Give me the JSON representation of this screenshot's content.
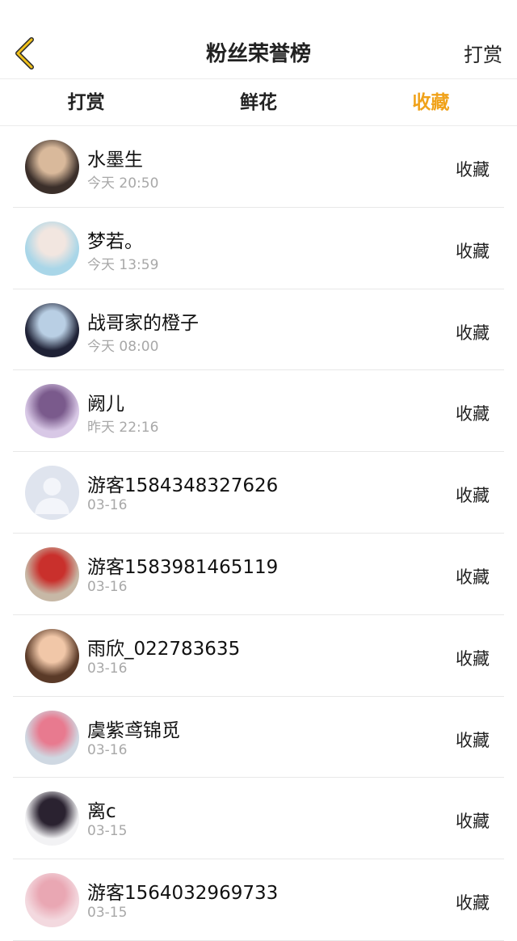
{
  "header": {
    "title": "粉丝荣誉榜",
    "right_label": "打赏",
    "back_icon": "chevron-left-icon",
    "accent": "#f0a21a"
  },
  "tabs": [
    {
      "label": "打赏",
      "active": false
    },
    {
      "label": "鲜花",
      "active": false
    },
    {
      "label": "收藏",
      "active": true
    }
  ],
  "fans": [
    {
      "name": "水墨生",
      "time": "今天 20:50",
      "action": "收藏",
      "avatar_colors": [
        "#3b2f2a",
        "#d9b99b"
      ]
    },
    {
      "name": "梦若。",
      "time": "今天 13:59",
      "action": "收藏",
      "avatar_colors": [
        "#a9d6e8",
        "#f2e6e0"
      ]
    },
    {
      "name": "战哥家的橙子",
      "time": "今天 08:00",
      "action": "收藏",
      "avatar_colors": [
        "#1f2236",
        "#b9cfe4"
      ]
    },
    {
      "name": "阙儿",
      "time": "昨天 22:16",
      "action": "收藏",
      "avatar_colors": [
        "#d8c8e6",
        "#7a5a8c"
      ]
    },
    {
      "name": "游客1584348327626",
      "time": "03-16",
      "action": "收藏",
      "avatar_colors": [
        "#dfe4ee",
        "#c4cbdb"
      ]
    },
    {
      "name": "游客1583981465119",
      "time": "03-16",
      "action": "收藏",
      "avatar_colors": [
        "#c7b8a6",
        "#c9302c"
      ]
    },
    {
      "name": "雨欣_022783635",
      "time": "03-16",
      "action": "收藏",
      "avatar_colors": [
        "#5a3a28",
        "#f1c7a8"
      ]
    },
    {
      "name": "虞紫鸢锦觅",
      "time": "03-16",
      "action": "收藏",
      "avatar_colors": [
        "#cfd8e2",
        "#e87a8f"
      ]
    },
    {
      "name": "离c",
      "time": "03-15",
      "action": "收藏",
      "avatar_colors": [
        "#f2f2f4",
        "#2a2230"
      ]
    },
    {
      "name": "游客1564032969733",
      "time": "03-15",
      "action": "收藏",
      "avatar_colors": [
        "#f3d9df",
        "#e9a7b3"
      ]
    }
  ]
}
